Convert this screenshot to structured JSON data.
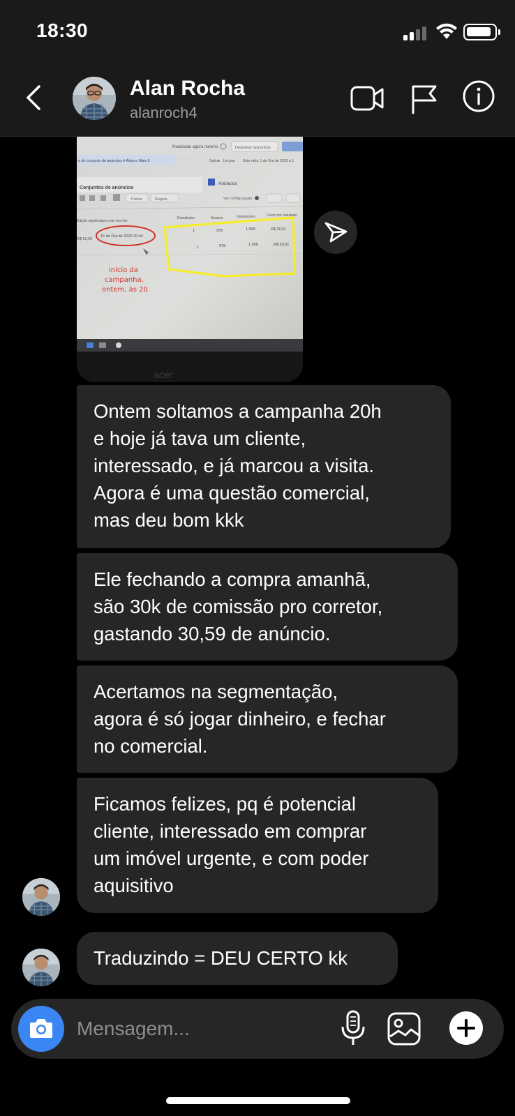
{
  "status_bar": {
    "time": "18:30"
  },
  "header": {
    "name": "Alan Rocha",
    "handle": "alanroch4"
  },
  "screenshot_photo": {
    "toolbar_text": "Atualizado agora mesmo",
    "discard_label": "Descartar rascunhos",
    "filter_text": "o do conjunto de anúncios é Ativa e Mais 5",
    "save_label": "Salvar",
    "clear_label": "Limpar",
    "period_text": "Este mês: 1 de Out de 2020 a 1",
    "adsets_tab": "Conjuntos de anúncios",
    "ads_tab": "Anúncios",
    "preview_label": "Prévia",
    "rules_label": "Regras",
    "view_config": "Ver configuração",
    "columns": [
      "Edição significativa mais recente",
      "Resultados",
      "Alcance",
      "Impressões",
      "Custo por resultado"
    ],
    "row_budget": "R$ 50,00",
    "row_date": "16 de Out de 2020 20:44",
    "row_results": "1",
    "row_reach": "978",
    "row_impressions": "1.008",
    "row_cost": "R$ 30,51",
    "annotation": "início da campanha, ontem, às 20",
    "monitor_brand": "acer"
  },
  "messages": [
    "Ontem soltamos a campanha 20h\ne hoje já tava um cliente,\ninteressado, e já marcou a visita.\nAgora é uma questão comercial,\nmas deu bom kkk",
    "Ele fechando a compra amanhã,\nsão 30k de comissão pro corretor,\ngastando 30,59 de anúncio.",
    "Acertamos na segmentação,\nagora é só jogar dinheiro, e fechar\nno comercial.",
    "Ficamos felizes, pq é potencial\ncliente, interessado em comprar\num imóvel urgente, e com poder\naquisitivo",
    "Traduzindo = DEU CERTO kk"
  ],
  "composer": {
    "placeholder": "Mensagem..."
  },
  "colors": {
    "accent": "#3a86f3",
    "bubble": "#262626",
    "bar": "#1a1a1a"
  }
}
